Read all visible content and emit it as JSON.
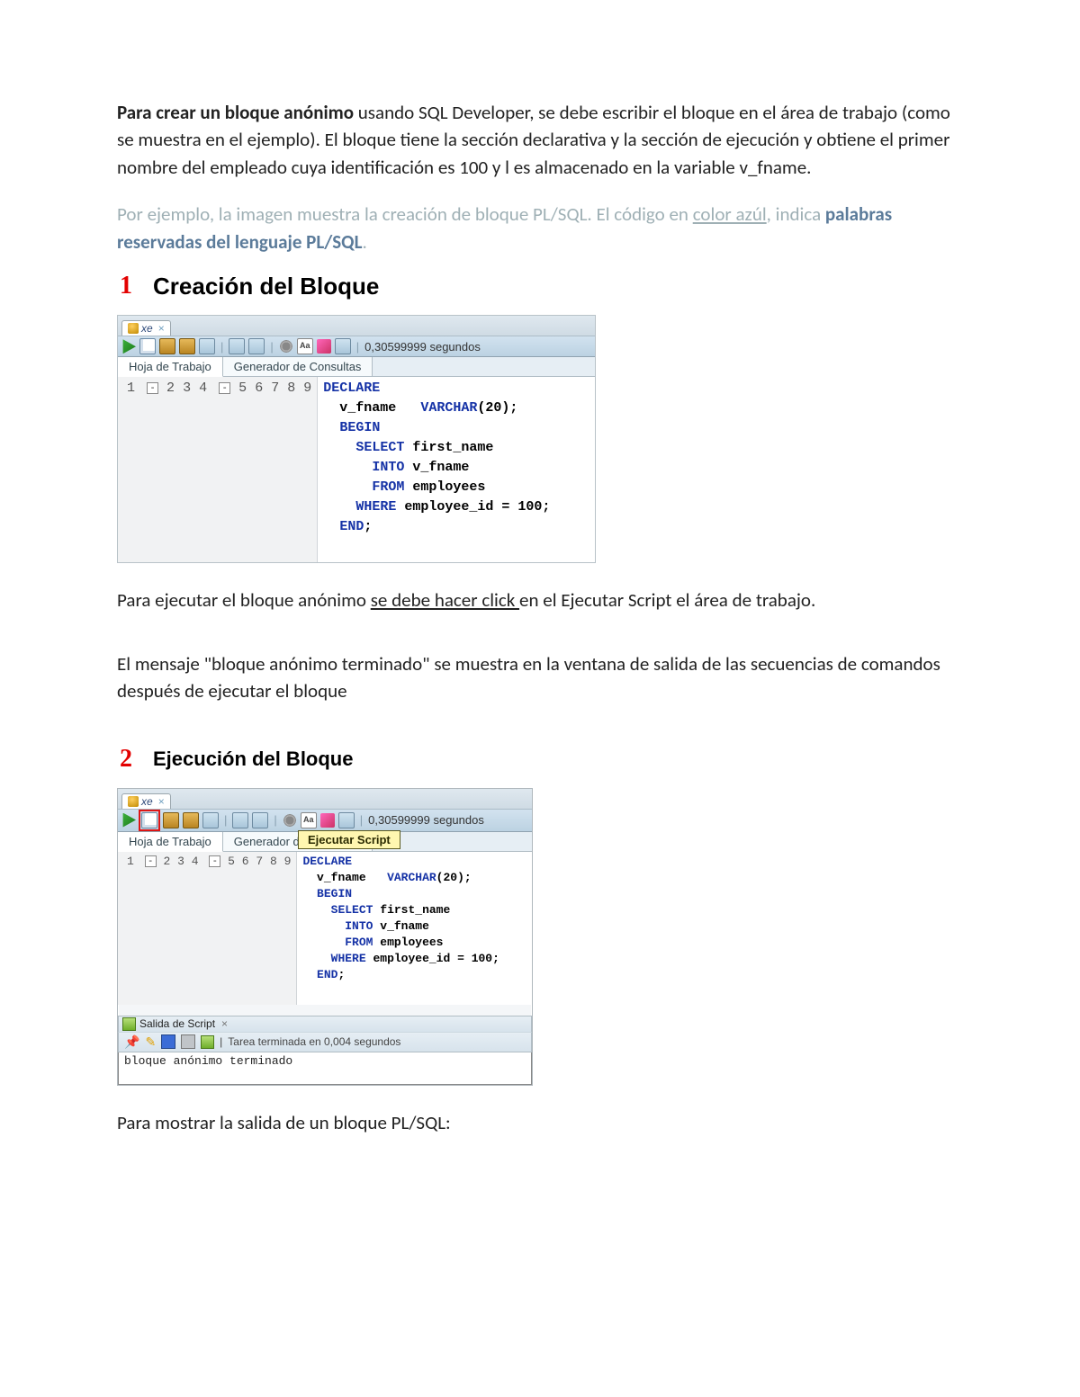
{
  "para": {
    "intro_bold": "Para crear un bloque anónimo",
    "intro_rest": " usando SQL Developer, se debe escribir el bloque en el área de trabajo (como se muestra en el ejemplo). El bloque tiene la sección declarativa y la sección de ejecución y obtiene el primer nombre del empleado cuya identificación es 100 y l es almacenado en la variable v_fname.",
    "grey_pre": " Por ejemplo, la imagen muestra la creación de bloque PL/SQL. El código en ",
    "grey_ul": "color azúl",
    "grey_post": ", indica ",
    "grey_blue": "palabras reservadas del lenguaje PL/SQL",
    "grey_end": ".",
    "exec_pre": "Para ejecutar el bloque anónimo ",
    "exec_ul": "se debe hacer click ",
    "exec_post": "en el Ejecutar Script el área de trabajo.",
    "msg": "El mensaje \"bloque anónimo terminado\" se muestra en la ventana de salida de las secuencias de comandos después de ejecutar el bloque",
    "out": "Para mostrar la salida de un bloque PL/SQL:"
  },
  "sec1": {
    "num": "1",
    "title": "Creación del Bloque"
  },
  "sec2": {
    "num": "2",
    "title": "Ejecución del Bloque"
  },
  "ide": {
    "tab_label": "xe",
    "tab_close": "×",
    "timing": "0,30599999 segundos",
    "subtab_worksheet": "Hoja de Trabajo",
    "subtab_query": "Generador de Consultas",
    "aa": "Aa",
    "tooltip": "Ejecutar Script"
  },
  "code": {
    "g": [
      "1",
      "2",
      "3",
      "4",
      "5",
      "6",
      "7",
      "8",
      "9"
    ],
    "l1a": "DECLARE",
    "l2a": "  v_fname   ",
    "l2b": "VARCHAR",
    "l2c": "(20);",
    "l3a": "  ",
    "l3b": "BEGIN",
    "l4a": "    ",
    "l4b": "SELECT",
    "l4c": " first_name",
    "l5a": "      ",
    "l5b": "INTO",
    "l5c": " v_fname",
    "l6a": "      ",
    "l6b": "FROM",
    "l6c": " employees",
    "l7a": "    ",
    "l7b": "WHERE",
    "l7c": " employee_id = 100;",
    "l8a": "  ",
    "l8b": "END",
    "l8c": ";"
  },
  "output": {
    "tab": "Salida de Script",
    "tab_close": "×",
    "status": "Tarea terminada en 0,004 segundos",
    "body": "bloque anónimo terminado"
  }
}
